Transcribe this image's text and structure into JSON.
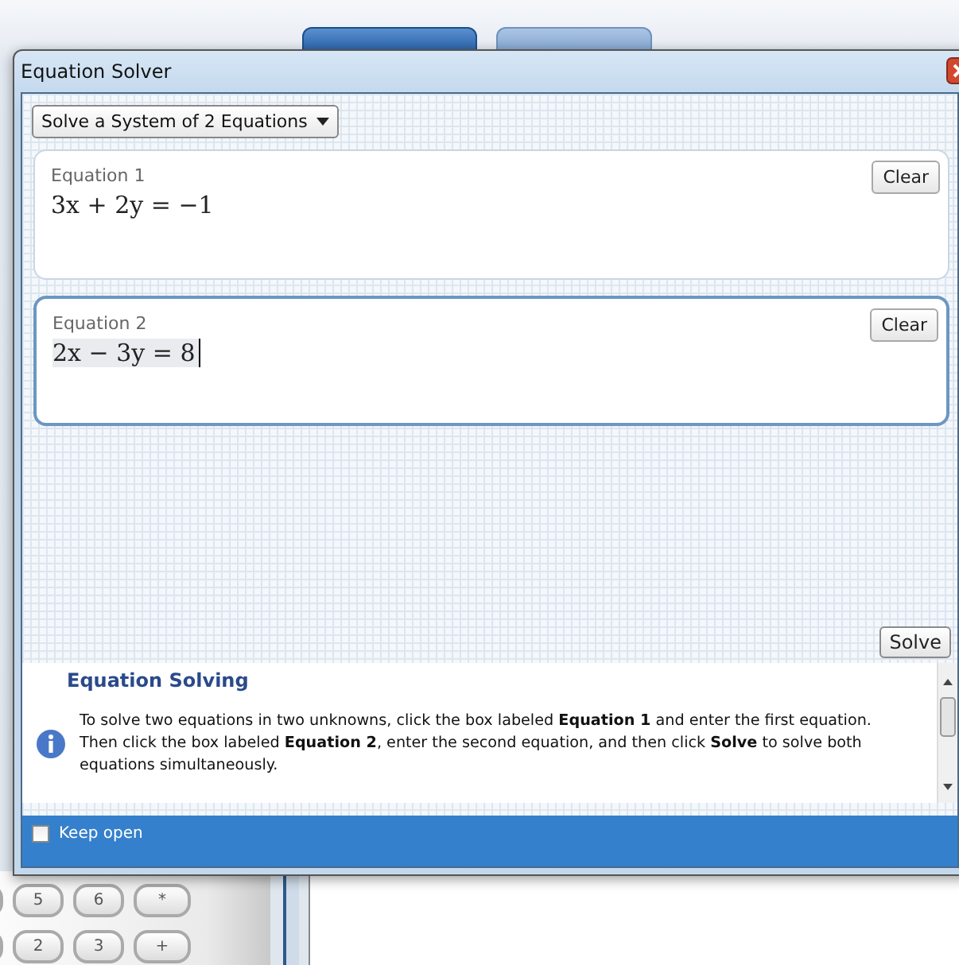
{
  "background_app": {
    "tabs": [
      {
        "selected": true
      },
      {
        "selected": false
      }
    ],
    "keypad": [
      [
        "5",
        "6",
        "*"
      ],
      [
        "2",
        "3",
        "+"
      ]
    ]
  },
  "dialog": {
    "title": "Equation Solver",
    "mode_dropdown": "Solve a System of 2 Equations",
    "equations": [
      {
        "label": "Equation 1",
        "value": "3x + 2y = −1",
        "focused": false,
        "clear": "Clear"
      },
      {
        "label": "Equation 2",
        "value": "2x − 3y = 8",
        "focused": true,
        "clear": "Clear"
      }
    ],
    "solve_button": "Solve",
    "help": {
      "title": "Equation Solving",
      "text": "To solve two equations in two unknowns, click the box labeled **Equation 1** and enter the first equation. Then click the box labeled **Equation 2**, enter the second equation, and then click **Solve**  to solve both equations simultaneously."
    },
    "keep_open": {
      "label": "Keep open",
      "checked": false
    }
  }
}
